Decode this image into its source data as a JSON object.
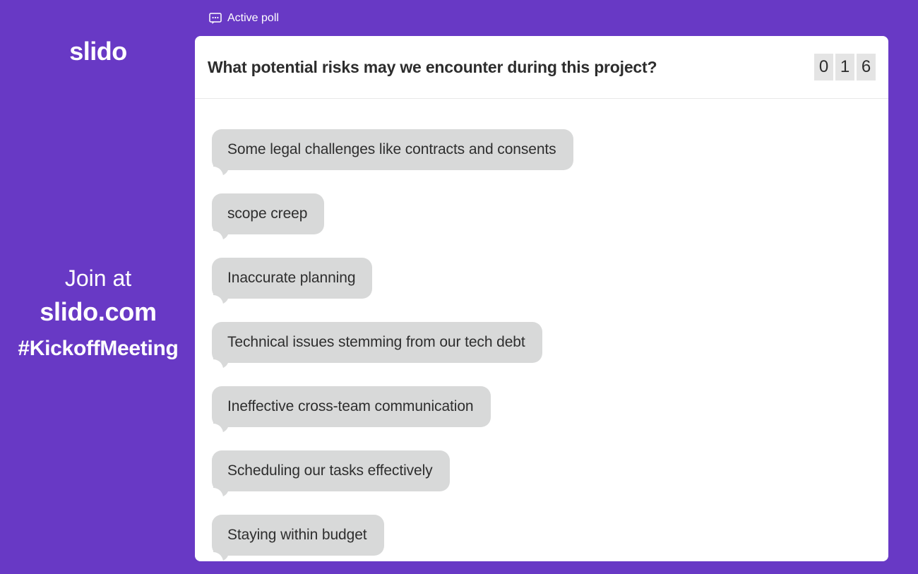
{
  "theme": {
    "background_purple": "#6839c5",
    "card_background": "#ffffff",
    "bubble_gray": "#d8d9d9",
    "counter_tile_gray": "#e4e4e4",
    "text_dark": "#2d2d2d",
    "text_white": "#ffffff"
  },
  "sidebar": {
    "logo_text": "slido",
    "join_at_label": "Join at",
    "join_domain": "slido.com",
    "event_hashtag": "#KickoffMeeting"
  },
  "status_bar": {
    "icon": "poll-speech-bubble-icon",
    "label": "Active poll"
  },
  "poll": {
    "question": "What potential risks may we encounter during this project?",
    "response_counter": {
      "digits": [
        "0",
        "1",
        "6"
      ],
      "value": "016"
    },
    "answers": [
      {
        "text": "Some legal challenges like contracts and consents"
      },
      {
        "text": "scope creep"
      },
      {
        "text": "Inaccurate planning"
      },
      {
        "text": "Technical issues stemming from our tech debt"
      },
      {
        "text": "Ineffective cross-team communication"
      },
      {
        "text": "Scheduling our tasks effectively"
      },
      {
        "text": "Staying within budget"
      }
    ]
  }
}
